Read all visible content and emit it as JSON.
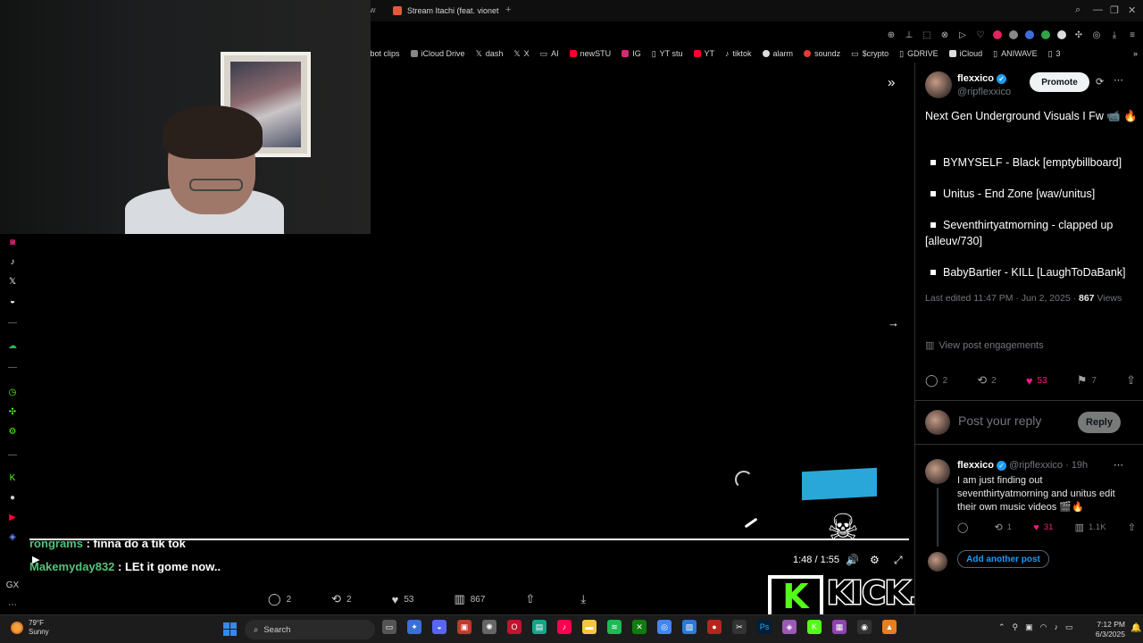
{
  "browser": {
    "tab_left_fragment": "w",
    "active_tab": "Stream Itachi (feat. vionet",
    "new_tab": "+",
    "window_controls": [
      "⌕",
      "—",
      "❐",
      "✕"
    ],
    "bookmarks": [
      "kbot clips",
      "iCloud Drive",
      "dash",
      "X",
      "AI",
      "newSTU",
      "IG",
      "YT stu",
      "YT",
      "tiktok",
      "alarm",
      "soundz",
      "$crypto",
      "GDRIVE",
      "iCloud",
      "ANIWAVE",
      "3"
    ],
    "bookmarks_more": "»"
  },
  "chat": [
    {
      "user": "rongrams",
      "sep": " : ",
      "message": "finna do a tik tok"
    },
    {
      "user": "Makemyday832",
      "sep": " : ",
      "message": "LEt it gome now.."
    }
  ],
  "player": {
    "time": "1:48 / 1:55",
    "expand_icon": "»",
    "next_icon": "→"
  },
  "action_bar": [
    {
      "icon": "reply-icon",
      "count": "2"
    },
    {
      "icon": "repost-icon",
      "count": "2"
    },
    {
      "icon": "like-icon",
      "count": "53"
    },
    {
      "icon": "views-icon",
      "count": "867"
    },
    {
      "icon": "share-icon",
      "count": ""
    },
    {
      "icon": "download-icon",
      "count": ""
    }
  ],
  "overlay": {
    "kick_k": "K",
    "kick_text": "KICK.COM/FLEXXICO"
  },
  "post": {
    "name": "flexxico",
    "handle": "@ripflexxico",
    "promote": "Promote",
    "text": "Next Gen Underground Visuals I Fw 📹 🔥",
    "bullets": [
      "BYMYSELF - Black [emptybillboard]",
      "Unitus - End Zone [wav/unitus]",
      "Seventhirtyatmorning - clapped up [alleuv/730]",
      "BabyBartier - KILL [LaughToDaBank]"
    ],
    "edited_prefix": "Last edited 11:47 PM · Jun 2, 2025 · ",
    "views_count": "867",
    "views_label": " Views",
    "engagements": "View post engagements",
    "stats": {
      "replies": "2",
      "reposts": "2",
      "likes": "53",
      "bookmarks": "7"
    }
  },
  "reply_box": {
    "placeholder": "Post your reply",
    "button": "Reply"
  },
  "reply": {
    "name": "flexxico",
    "handle": "@ripflexxico · 19h",
    "text": "I am just finding out seventhirtyatmorning and unitus edit their own music videos 🎬🔥",
    "stats": {
      "replies": "",
      "reposts": "1",
      "likes": "31",
      "views": "1.1K"
    },
    "add_post": "Add another post"
  },
  "taskbar": {
    "temp": "79°F",
    "condition": "Sunny",
    "search": "Search",
    "time": "7:12 PM",
    "date": "6/3/2025"
  },
  "colors": {
    "accent": "#1d9bf0",
    "like": "#f91880",
    "kick_green": "#53fc18",
    "chat_user": "#54c27a"
  }
}
